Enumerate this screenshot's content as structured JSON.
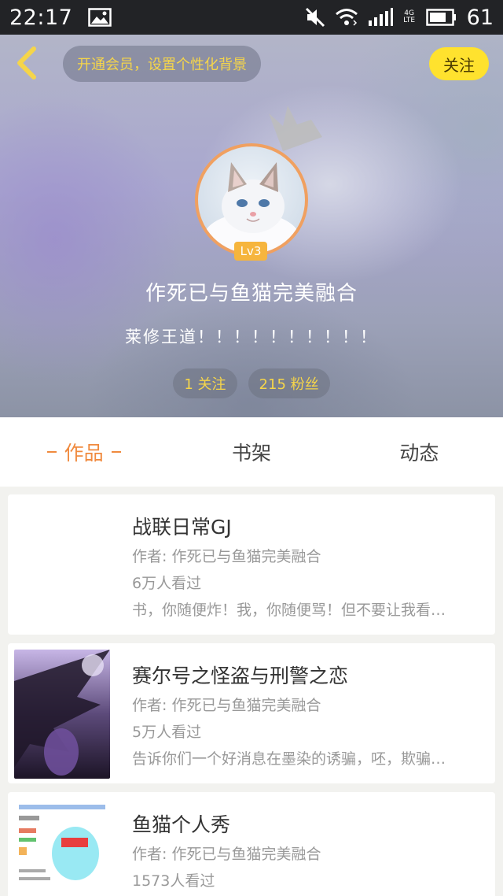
{
  "status_bar": {
    "time": "22:17",
    "network": "4G LTE",
    "battery": "61",
    "icons": [
      "image-icon",
      "mute-icon",
      "wifi-icon",
      "signal-icon",
      "battery-icon"
    ]
  },
  "header": {
    "back_icon": "chevron-left-icon",
    "vip_prompt": "开通会员，设置个性化背景",
    "follow_label": "关注",
    "level": "Lv3",
    "nickname": "作死已与鱼猫完美融合",
    "signature": "莱修王道！！！！！！！！！！",
    "following": "1 关注",
    "fans": "215 粉丝"
  },
  "tabs": [
    {
      "label": "作品",
      "active": true
    },
    {
      "label": "书架",
      "active": false
    },
    {
      "label": "动态",
      "active": false
    }
  ],
  "books": [
    {
      "title": "战联日常GJ",
      "author": "作者: 作死已与鱼猫完美融合",
      "views": "6万人看过",
      "desc": "书，你随便炸！我，你随便骂！但不要让我看…"
    },
    {
      "title": "赛尔号之怪盗与刑警之恋",
      "author": "作者: 作死已与鱼猫完美融合",
      "views": "5万人看过",
      "desc": "告诉你们一个好消息在墨染的诱骗，呸，欺骗…"
    },
    {
      "title": "鱼猫个人秀",
      "author": "作者: 作死已与鱼猫完美融合",
      "views": "1573人看过",
      "desc": ""
    }
  ],
  "colors": {
    "accent": "#f08a3e",
    "follow_button": "#ffe22e",
    "pill_text": "#f5d54a",
    "level_badge": "#f6b53d"
  }
}
